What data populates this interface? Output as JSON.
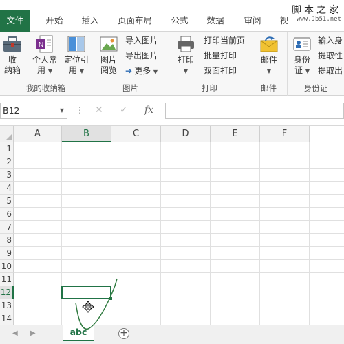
{
  "ribbon_tabs": [
    {
      "label": "文件"
    },
    {
      "label": "开始"
    },
    {
      "label": "插入"
    },
    {
      "label": "页面布局"
    },
    {
      "label": "公式"
    },
    {
      "label": "数据"
    },
    {
      "label": "审阅"
    },
    {
      "label": "视"
    }
  ],
  "watermark": {
    "line1": "脚本之家",
    "line2": "www.Jb51.net"
  },
  "groups": {
    "storage": {
      "label": "我的收纳箱",
      "buttons": [
        {
          "line1": "收",
          "line2": "纳箱"
        },
        {
          "line1": "个人常",
          "line2": "用"
        },
        {
          "line1": "定位引",
          "line2": "用"
        }
      ]
    },
    "picture": {
      "label": "图片",
      "big": {
        "line1": "图片",
        "line2": "阅览"
      },
      "small": [
        {
          "label": "导入图片"
        },
        {
          "label": "导出图片"
        },
        {
          "label": "更多"
        }
      ]
    },
    "print": {
      "label": "打印",
      "big": {
        "line1": "打印"
      },
      "small": [
        {
          "label": "打印当前页"
        },
        {
          "label": "批量打印"
        },
        {
          "label": "双面打印"
        }
      ]
    },
    "mail": {
      "label": "邮件",
      "big": {
        "line1": "邮件"
      }
    },
    "idcard": {
      "label": "身份证",
      "big": {
        "line1": "身份",
        "line2": "证"
      },
      "small": [
        {
          "label": "输入身"
        },
        {
          "label": "提取性"
        },
        {
          "label": "提取出"
        }
      ]
    }
  },
  "formula_bar": {
    "name_box": "B12",
    "fx": "fx",
    "value": ""
  },
  "columns": [
    "A",
    "B",
    "C",
    "D",
    "E",
    "F"
  ],
  "rows": [
    "1",
    "2",
    "3",
    "4",
    "5",
    "6",
    "7",
    "8",
    "9",
    "10",
    "11",
    "12",
    "13",
    "14"
  ],
  "selected": {
    "column": "B",
    "row": "12"
  },
  "sheets": [
    {
      "name": "abc"
    }
  ],
  "colors": {
    "accent": "#217346"
  }
}
